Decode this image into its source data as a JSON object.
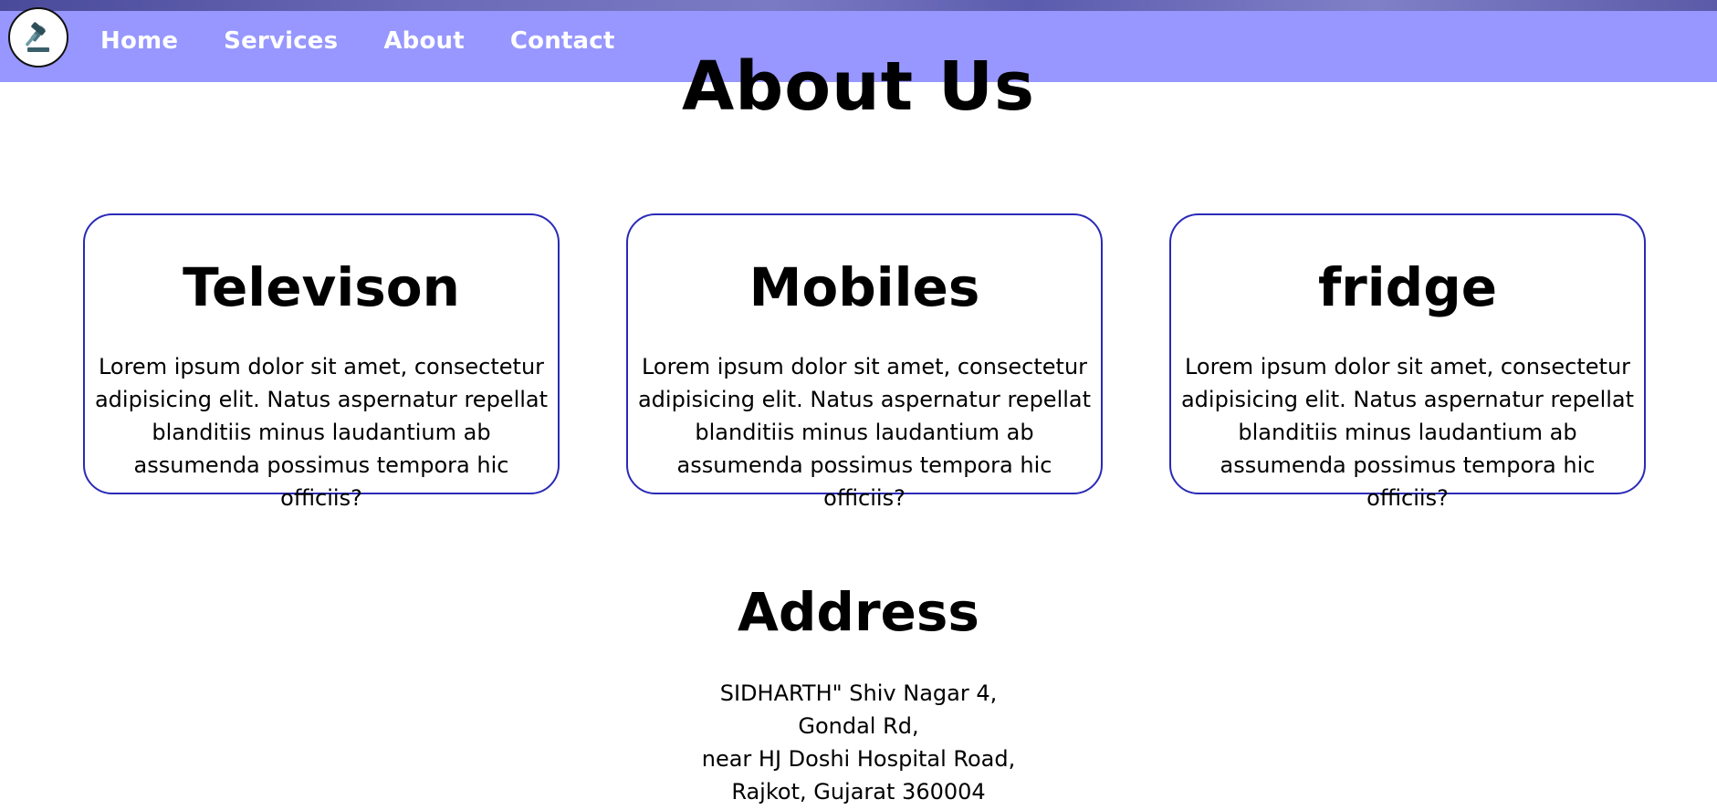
{
  "nav": {
    "logo_icon": "gavel-icon",
    "links": [
      "Home",
      "Services",
      "About",
      "Contact"
    ]
  },
  "about": {
    "title": "About Us"
  },
  "cards": [
    {
      "title": "Televison",
      "text": "Lorem ipsum dolor sit amet, consectetur adipisicing elit. Natus aspernatur repellat blanditiis minus laudantium ab assumenda possimus tempora hic officiis?"
    },
    {
      "title": "Mobiles",
      "text": "Lorem ipsum dolor sit amet, consectetur adipisicing elit. Natus aspernatur repellat blanditiis minus laudantium ab assumenda possimus tempora hic officiis?"
    },
    {
      "title": "fridge",
      "text": "Lorem ipsum dolor sit amet, consectetur adipisicing elit. Natus aspernatur repellat blanditiis minus laudantium ab assumenda possimus tempora hic officiis?"
    }
  ],
  "address": {
    "title": "Address",
    "lines": [
      "SIDHARTH\" Shiv Nagar 4,",
      "Gondal Rd,",
      "near HJ Doshi Hospital Road,",
      "Rajkot, Gujarat 360004"
    ]
  },
  "colors": {
    "nav_bg": "#8c8cff",
    "card_border": "#2a2ab8",
    "nav_text": "#ffffff"
  }
}
